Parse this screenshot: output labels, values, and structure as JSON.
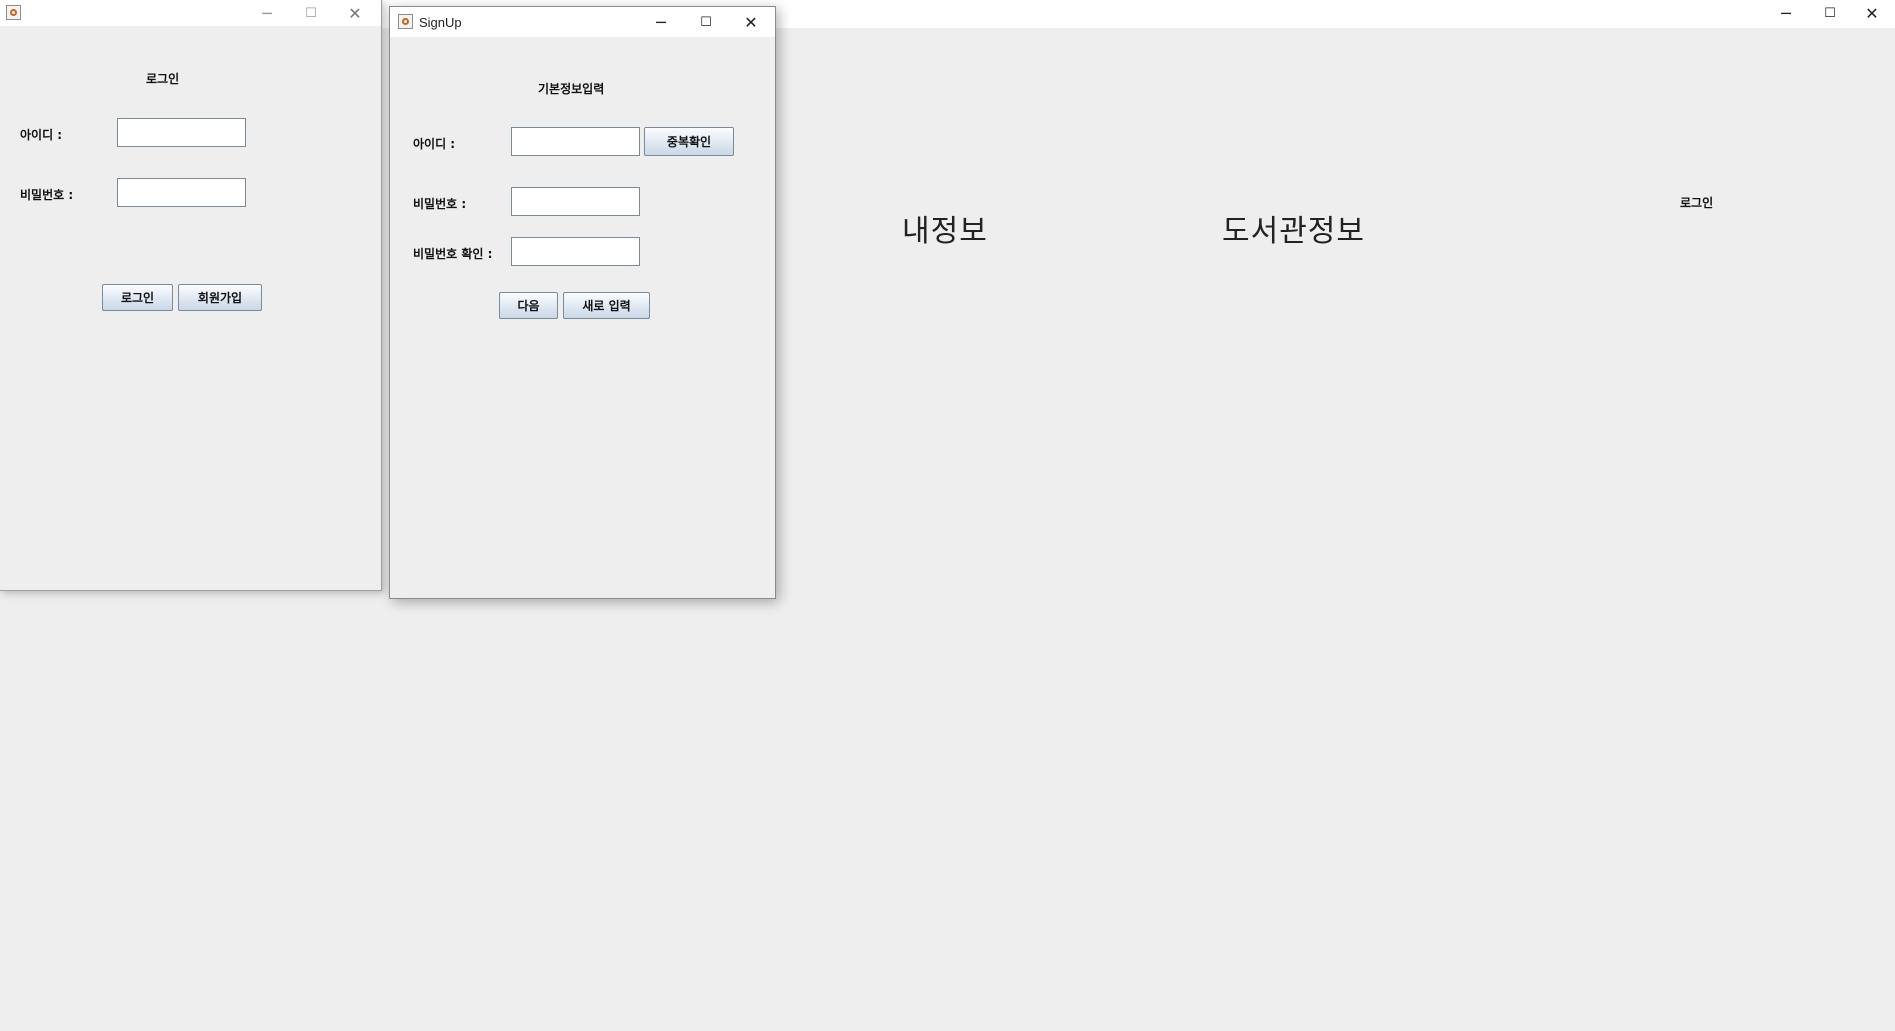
{
  "main_window": {
    "tabs": [
      "내정보",
      "도서관정보"
    ],
    "login_label": "로그인",
    "controls": {
      "minimize": "─",
      "maximize": "☐",
      "close": "✕"
    }
  },
  "login_window": {
    "heading": "로그인",
    "id_label": "아이디 :",
    "password_label": "비밀번호 :",
    "id_value": "",
    "password_value": "",
    "login_button": "로그인",
    "signup_button": "회원가입",
    "controls": {
      "minimize": "─",
      "maximize": "☐",
      "close": "✕"
    }
  },
  "signup_window": {
    "title": "SignUp",
    "heading": "기본정보입력",
    "id_label": "아이디 :",
    "password_label": "비밀번호 :",
    "password_confirm_label": "비밀번호 확인 :",
    "id_value": "",
    "password_value": "",
    "password_confirm_value": "",
    "check_duplicate_button": "중복확인",
    "next_button": "다음",
    "reset_button": "새로 입력",
    "controls": {
      "minimize": "─",
      "maximize": "☐",
      "close": "✕"
    }
  }
}
